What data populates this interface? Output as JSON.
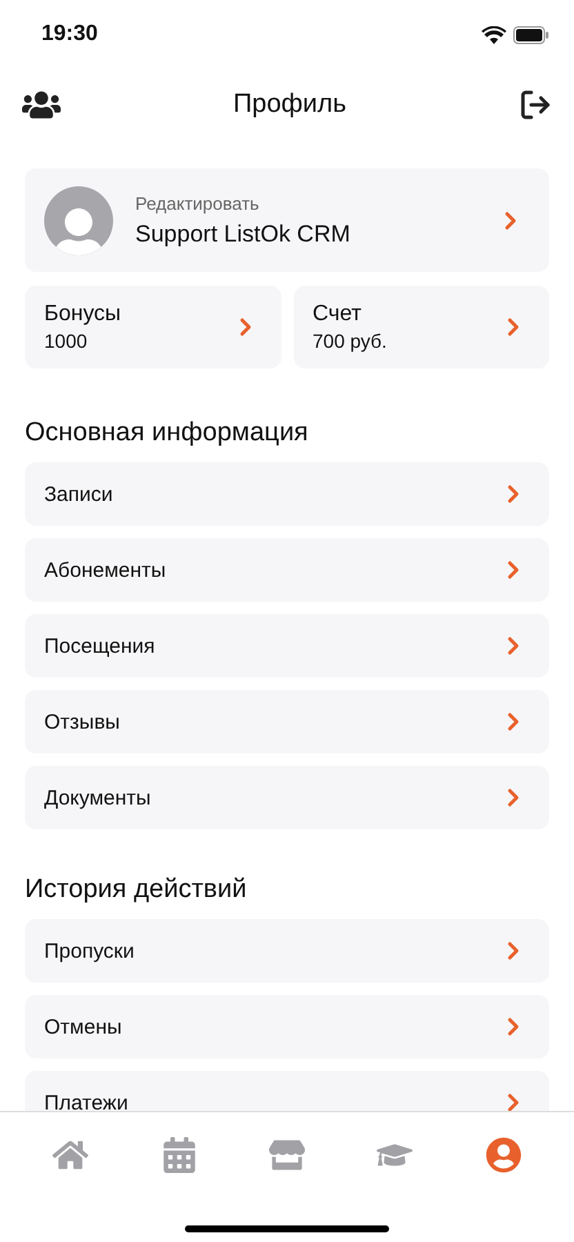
{
  "status_bar": {
    "time": "19:30"
  },
  "header": {
    "title": "Профиль"
  },
  "profile": {
    "caption": "Редактировать",
    "name": "Support ListOk CRM"
  },
  "balances": [
    {
      "label": "Бонусы",
      "value": "1000"
    },
    {
      "label": "Счет",
      "value": "700 руб."
    }
  ],
  "sections": [
    {
      "title": "Основная информация",
      "items": [
        "Записи",
        "Абонементы",
        "Посещения",
        "Отзывы",
        "Документы"
      ]
    },
    {
      "title": "История действий",
      "items": [
        "Пропуски",
        "Отмены",
        "Платежи"
      ]
    }
  ],
  "tab_bar": [
    {
      "kind": "home",
      "selected": false
    },
    {
      "kind": "calendar",
      "selected": false
    },
    {
      "kind": "store",
      "selected": false
    },
    {
      "kind": "education",
      "selected": false
    },
    {
      "kind": "profile",
      "selected": true
    }
  ]
}
